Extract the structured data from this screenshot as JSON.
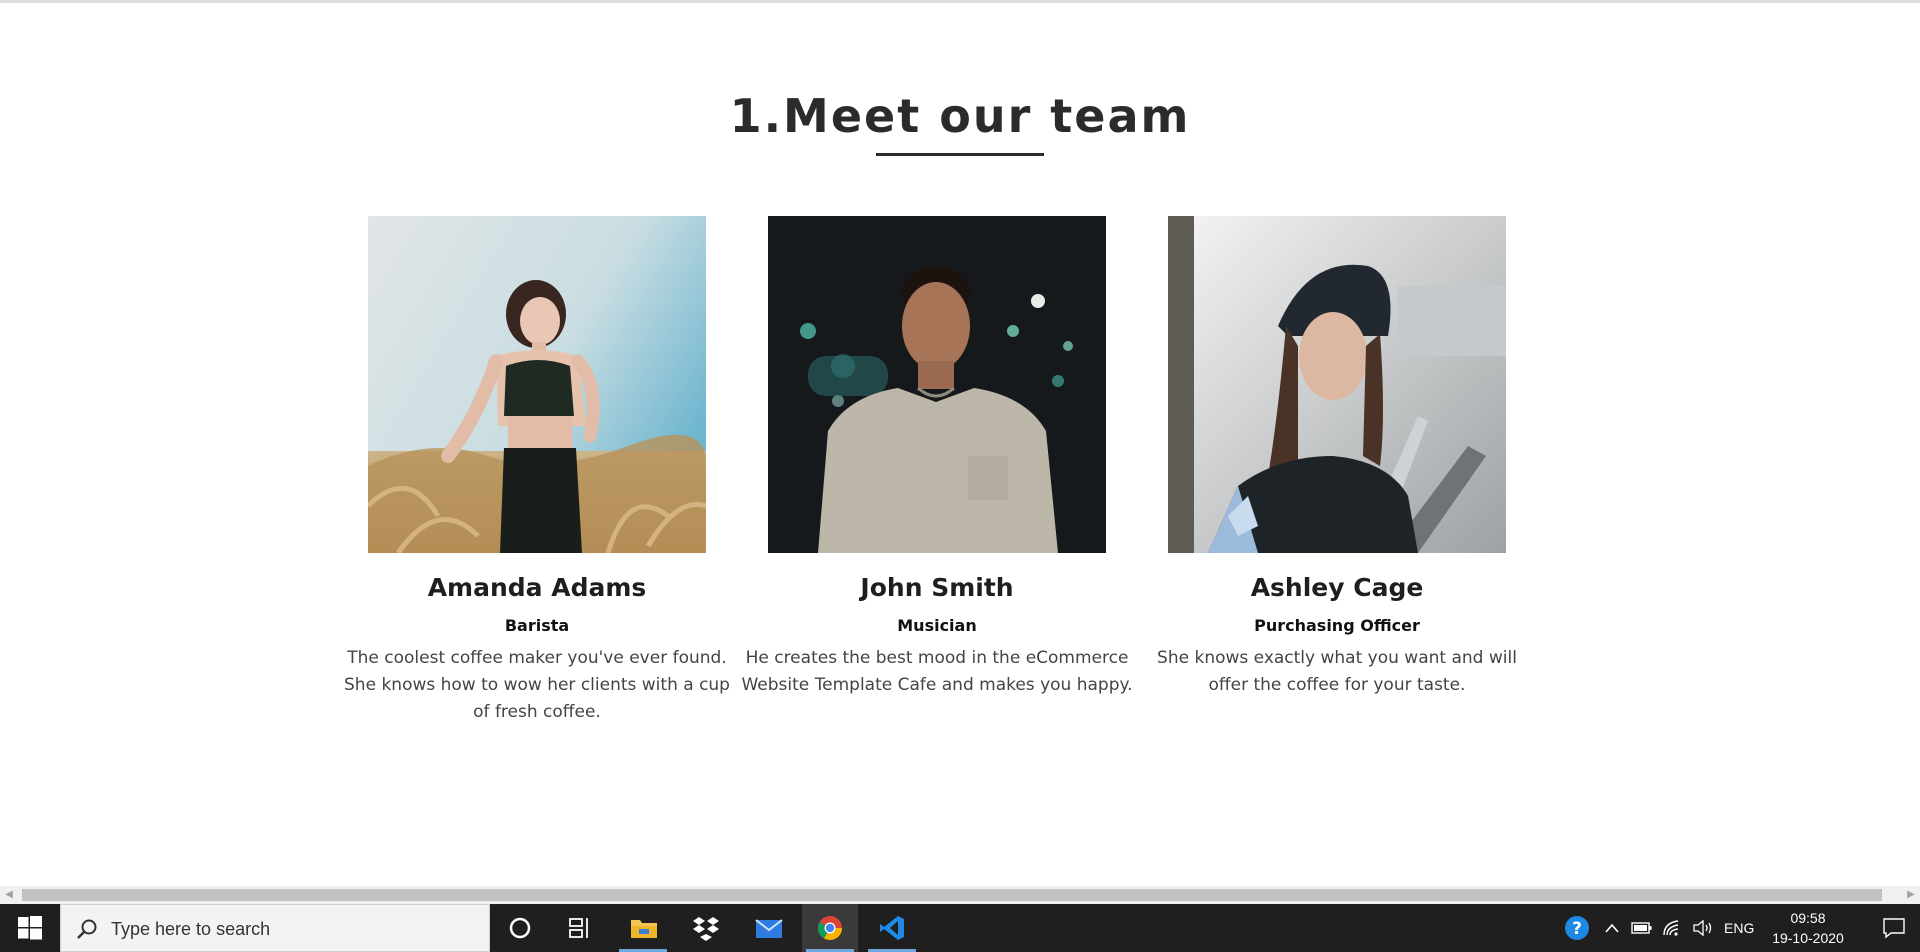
{
  "section": {
    "title": "1.Meet our team"
  },
  "team": [
    {
      "name": "Amanda Adams",
      "role": "Barista",
      "description": "The coolest coffee maker you've ever found. She knows how to wow her clients with a cup of fresh coffee."
    },
    {
      "name": "John Smith",
      "role": "Musician",
      "description": "He creates the best mood in the eCommerce Website Template Cafe and makes you happy."
    },
    {
      "name": "Ashley Cage",
      "role": "Purchasing Officer",
      "description": "She knows exactly what you want and will offer the coffee for your taste."
    }
  ],
  "taskbar": {
    "search_placeholder": "Type here to search",
    "apps": [
      "cortana-icon",
      "task-view-icon",
      "file-explorer-icon",
      "dropbox-icon",
      "mail-icon",
      "chrome-icon",
      "vscode-icon"
    ],
    "language": "ENG",
    "time": "09:58",
    "date": "19-10-2020"
  },
  "colors": {
    "title": "#2b2b2b",
    "taskbar_bg": "#1f1f1f",
    "accent": "#6fa8dc"
  }
}
